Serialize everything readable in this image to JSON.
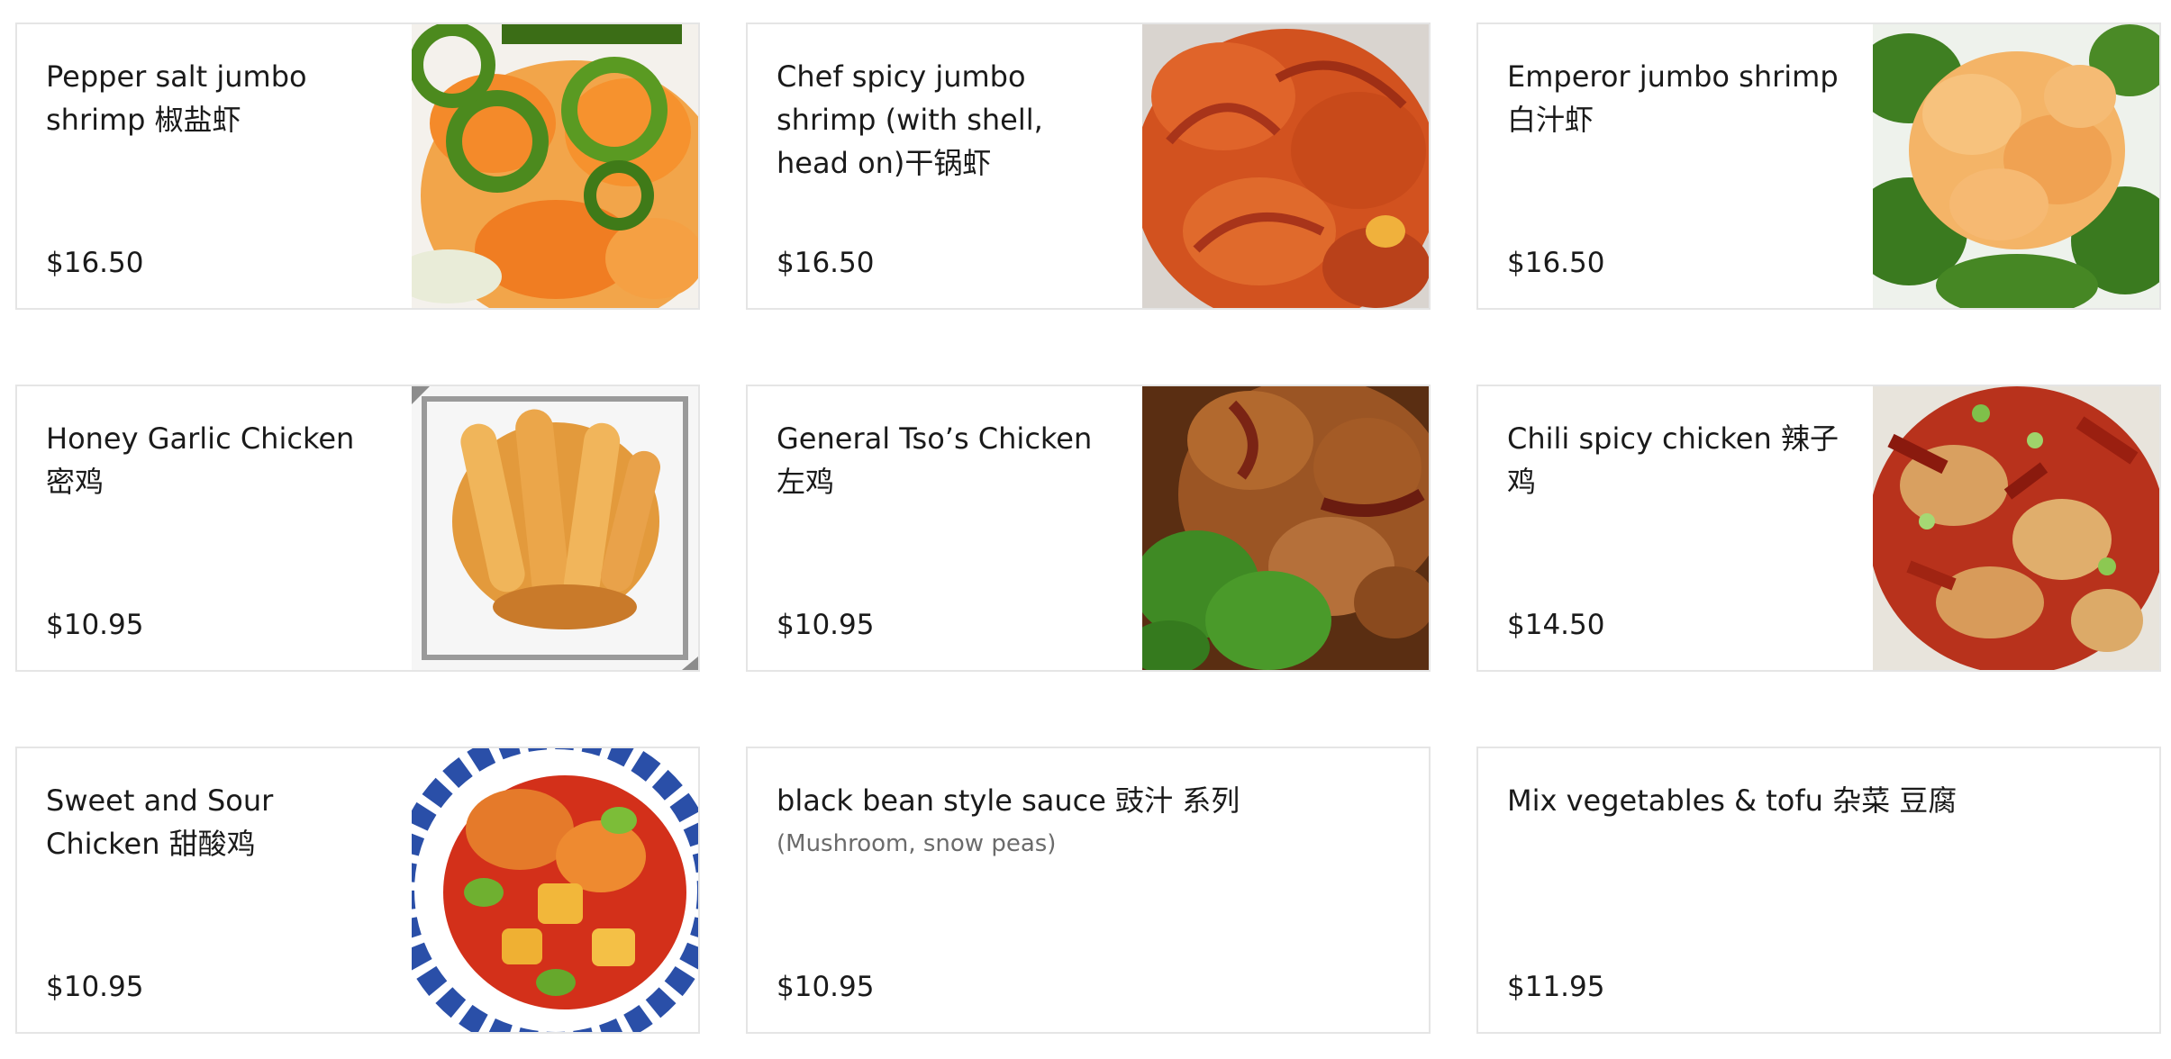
{
  "menu": {
    "items": [
      {
        "title": "Pepper salt jumbo shrimp 椒盐虾",
        "price": "$16.50",
        "image": "pepper-salt-shrimp-photo"
      },
      {
        "title": "Chef spicy jumbo shrimp (with shell, head on)干锅虾",
        "price": "$16.50",
        "image": "chef-spicy-shrimp-photo"
      },
      {
        "title": "Emperor jumbo shrimp 白汁虾",
        "price": "$16.50",
        "image": "emperor-shrimp-photo"
      },
      {
        "title": "Honey Garlic Chicken 密鸡",
        "price": "$10.95",
        "image": "honey-garlic-chicken-photo"
      },
      {
        "title": "General Tso’s Chicken左鸡",
        "price": "$10.95",
        "image": "general-tso-chicken-photo"
      },
      {
        "title": "Chili spicy chicken 辣子鸡",
        "price": "$14.50",
        "image": "chili-spicy-chicken-photo"
      },
      {
        "title": "Sweet and Sour Chicken 甜酸鸡",
        "price": "$10.95",
        "image": "sweet-sour-chicken-photo"
      },
      {
        "title": "black bean style sauce 豉汁 系列",
        "description": "(Mushroom, snow peas)",
        "price": "$10.95"
      },
      {
        "title": "Mix vegetables & tofu 杂菜 豆腐",
        "price": "$11.95"
      }
    ]
  }
}
